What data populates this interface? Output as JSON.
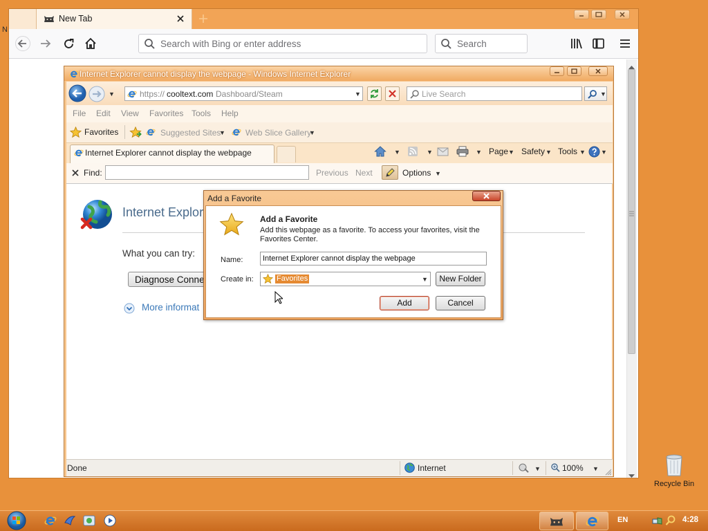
{
  "colors": {
    "desktop": "#e8913b",
    "taskbar": "#c96a1e",
    "selection": "#e58a32",
    "link": "#3a78b8"
  },
  "desktop": {
    "partial_label": "N",
    "recycle_bin": "Recycle Bin"
  },
  "taskbar": {
    "language": "EN",
    "clock": "4:28"
  },
  "firefox": {
    "tab_title": "New Tab",
    "address_placeholder": "Search with Bing or enter address",
    "search_placeholder": "Search",
    "toolbar_icons": [
      "back-icon",
      "forward-icon",
      "reload-icon",
      "home-icon",
      "library-icon",
      "sidebar-icon",
      "menu-icon"
    ]
  },
  "ie": {
    "title": "Internet Explorer cannot display the webpage - Windows Internet Explorer",
    "address": {
      "scheme": "https://",
      "domain": "cooltext.com",
      "path": "Dashboard/Steam"
    },
    "search_placeholder": "Live Search",
    "menu": [
      "File",
      "Edit",
      "View",
      "Favorites",
      "Tools",
      "Help"
    ],
    "favorites_bar": {
      "favorites": "Favorites",
      "suggested": "Suggested Sites",
      "web_slice": "Web Slice Gallery"
    },
    "tab": "Internet Explorer cannot display the webpage",
    "command_bar": {
      "page": "Page",
      "safety": "Safety",
      "tools": "Tools"
    },
    "find": {
      "label": "Find:",
      "previous": "Previous",
      "next": "Next",
      "options": "Options"
    },
    "content": {
      "heading": "Internet Explor",
      "try_label": "What you can try:",
      "diagnose_button": "Diagnose Connec",
      "more_info": "More informat"
    },
    "status": {
      "text": "Done",
      "zone": "Internet",
      "zoom": "100%"
    }
  },
  "dialog": {
    "title": "Add a Favorite",
    "heading": "Add a Favorite",
    "description": "Add this webpage as a favorite. To access your favorites, visit the Favorites Center.",
    "name_label": "Name:",
    "name_value": "Internet Explorer cannot display the webpage",
    "create_in_label": "Create in:",
    "create_in_value": "Favorites",
    "new_folder": "New Folder",
    "add": "Add",
    "cancel": "Cancel"
  }
}
